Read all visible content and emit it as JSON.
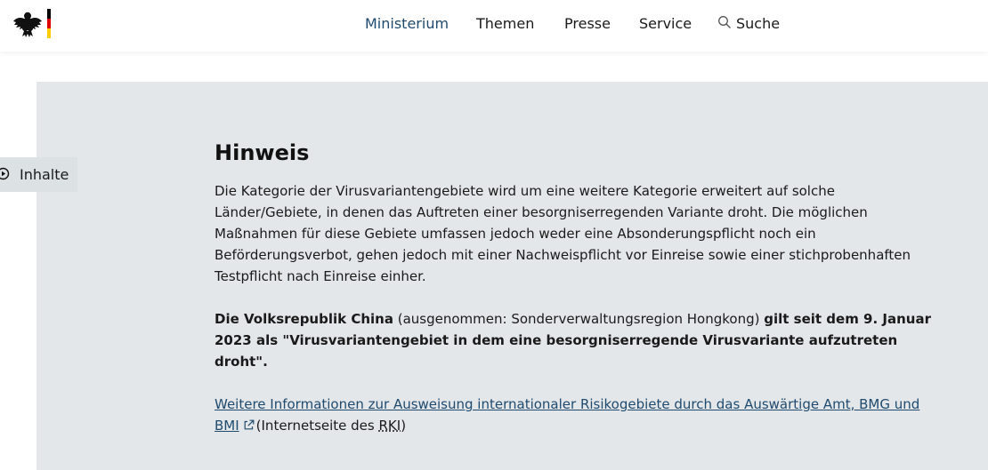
{
  "header": {
    "logo_icon": "federal-eagle-icon",
    "nav": {
      "ministerium": "Ministerium",
      "themen": "Themen",
      "presse": "Presse",
      "service": "Service",
      "suche": "Suche"
    },
    "active_color": "#1f4a6e"
  },
  "sidebar": {
    "inhalte_label": "Inhalte",
    "inhalte_icon": "play-circle-icon"
  },
  "notice": {
    "title": "Hinweis",
    "paragraph1": "Die Kategorie der Virusvariantengebiete wird um eine weitere Kategorie erweitert auf solche Länder/Gebiete, in denen das Auftreten einer besorgniserregenden Variante droht. Die möglichen Maßnahmen für diese Gebiete umfassen jedoch weder eine Absonderungspflicht noch ein Beförderungsverbot, gehen jedoch mit einer Nachweispflicht vor Einreise sowie einer stichprobenhaften Testpflicht nach Einreise einher.",
    "china_bold": "Die Volksrepublik China",
    "china_normal": " (ausgenommen: Sonderverwaltungsregion Hongkong) ",
    "china_bold2": "gilt seit dem 9. Januar 2023 als \"Virusvariantengebiet in dem eine besorgniserregende Virusvariante aufzutreten droht\".",
    "link_text": "Weitere Informationen zur Ausweisung internationaler Risikogebiete durch das Auswärtige Amt, BMG und BMI",
    "link_icon": "external-link-icon",
    "link_suffix_before": "(Internetseite des ",
    "link_suffix_abbr": "RKI",
    "link_suffix_after": ")"
  },
  "colors": {
    "panel_bg": "#e3e7e9",
    "link": "#1f4a6e"
  }
}
